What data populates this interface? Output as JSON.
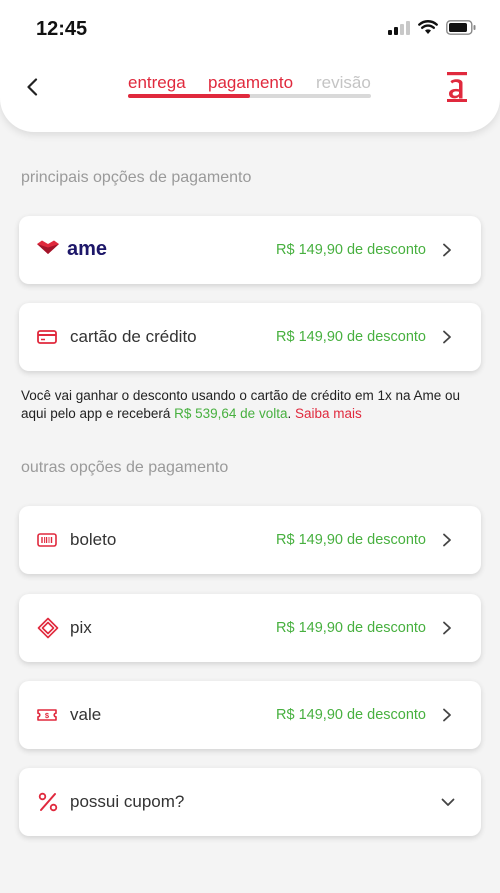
{
  "status_bar": {
    "time": "12:45"
  },
  "steps": [
    {
      "label": "entrega",
      "state": "active"
    },
    {
      "label": "pagamento",
      "state": "active"
    },
    {
      "label": "revisão",
      "state": "inactive"
    }
  ],
  "step_progress": 0.5,
  "sections": {
    "main_title": "principais opções de pagamento",
    "other_title": "outras opções de pagamento"
  },
  "main_options": [
    {
      "label": "ame",
      "discount": "R$ 149,90 de desconto",
      "icon": "ame-heart-logo"
    },
    {
      "label": "cartão de crédito",
      "discount": "R$ 149,90 de desconto",
      "icon": "credit-card-icon"
    }
  ],
  "info": {
    "text_before": "Você vai ganhar o desconto usando o cartão de crédito em 1x na Ame ou aqui pelo app e receberá ",
    "cashback": "R$ 539,64 de volta",
    "text_after": ". ",
    "link": "Saiba mais"
  },
  "other_options": [
    {
      "label": "boleto",
      "discount": "R$ 149,90 de desconto",
      "icon": "barcode-icon"
    },
    {
      "label": "pix",
      "discount": "R$ 149,90 de desconto",
      "icon": "pix-icon"
    },
    {
      "label": "vale",
      "discount": "R$ 149,90 de desconto",
      "icon": "voucher-icon"
    }
  ],
  "coupon": {
    "label": "possui cupom?",
    "icon": "percent-icon"
  },
  "colors": {
    "accent": "#e0293d",
    "discount": "#47b03f",
    "ame_brand": "#1d1769"
  }
}
